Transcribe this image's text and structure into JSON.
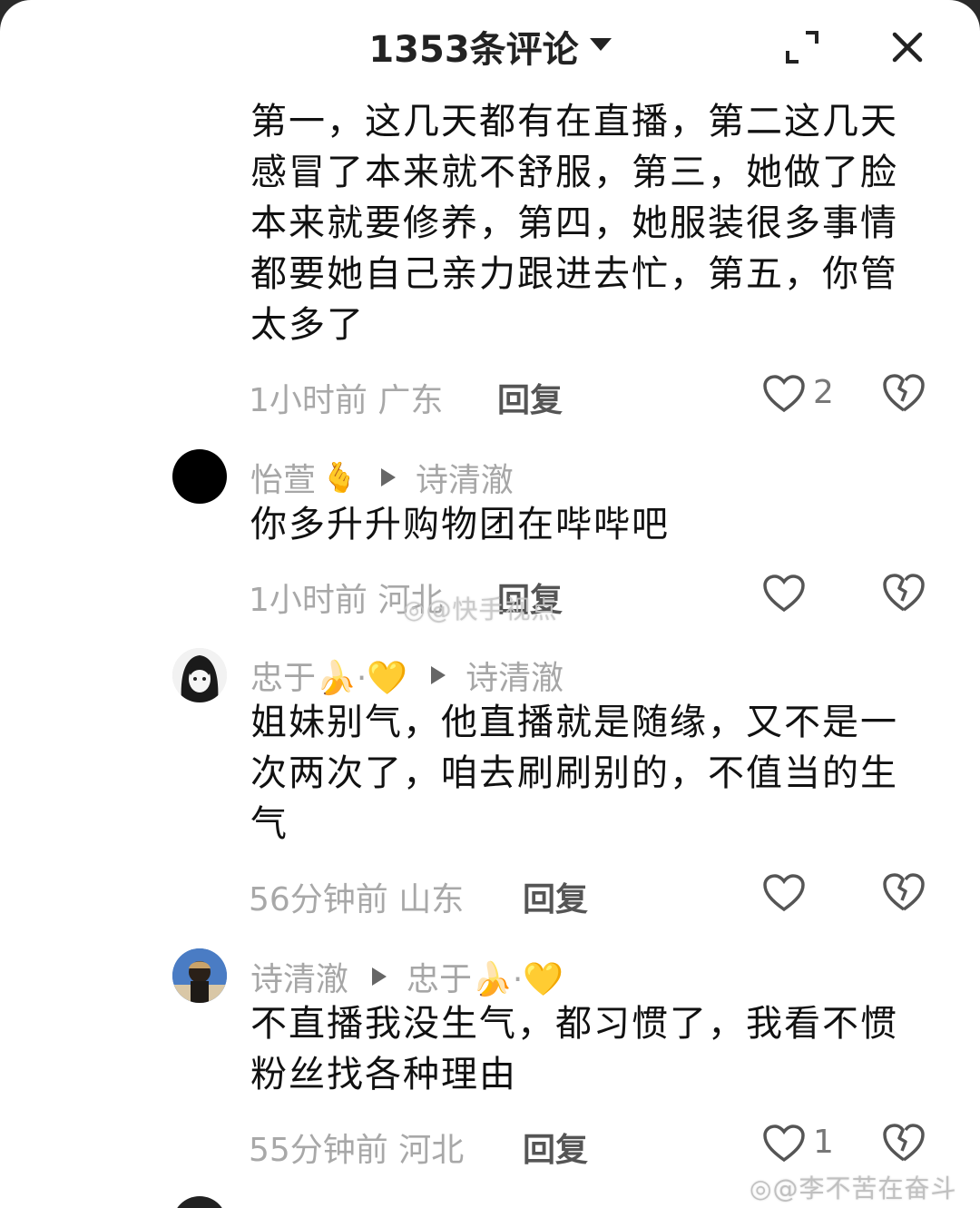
{
  "header": {
    "title": "1353条评论"
  },
  "comments": [
    {
      "text": "第一，这几天都有在直播，第二这几天感冒了本来就不舒服，第三，她做了脸本来就要修养，第四，她服装很多事情都要她自己亲力跟进去忙，第五，你管太多了",
      "time_location": "1小时前 广东",
      "reply_label": "回复",
      "like_count": "2"
    },
    {
      "author": "怡萱",
      "author_badge": "🫰",
      "reply_to": "诗清澈",
      "text": "你多升升购物团在哔哔吧",
      "time_location": "1小时前 河北",
      "reply_label": "回复",
      "like_count": ""
    },
    {
      "author": "忠于🍌·💛",
      "reply_to": "诗清澈",
      "text": "姐妹别气，他直播就是随缘，又不是一次两次了，咱去刷刷别的，不值当的生气",
      "time_location": "56分钟前 山东",
      "reply_label": "回复",
      "like_count": ""
    },
    {
      "author": "诗清澈",
      "reply_to": "忠于🍌·💛",
      "text": "不直播我没生气，都习惯了，我看不惯粉丝找各种理由",
      "time_location": "55分钟前 河北",
      "reply_label": "回复",
      "like_count": "1"
    }
  ],
  "watermarks": {
    "center": "@快手视点",
    "corner": "@李不苦在奋斗"
  },
  "colors": {
    "meta_gray": "#a6a6a6",
    "text_dark": "#111111",
    "background": "#ffffff"
  }
}
